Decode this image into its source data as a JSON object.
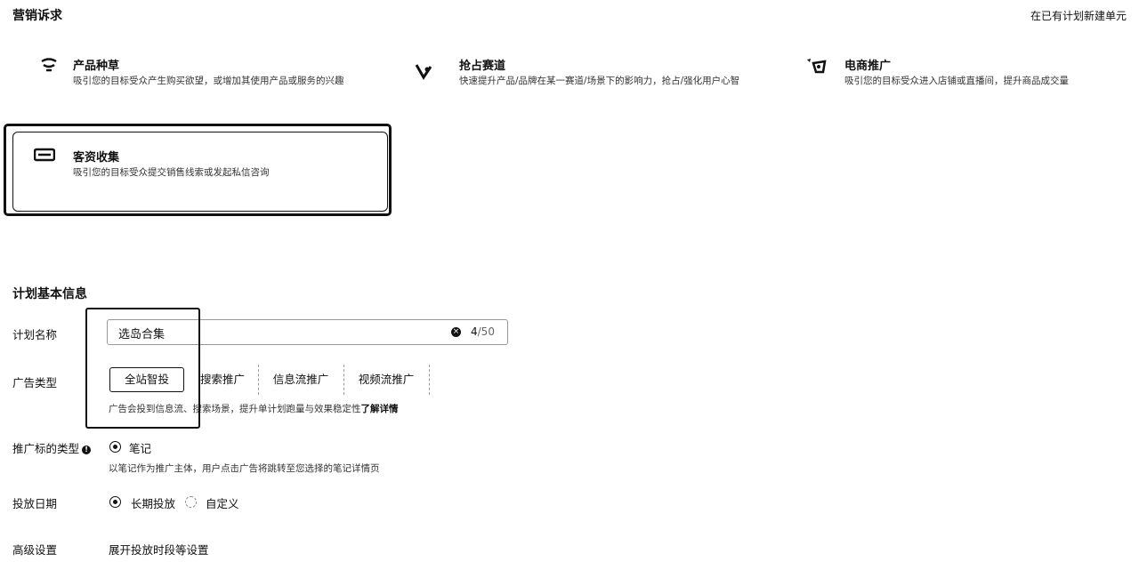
{
  "section_marketing": {
    "title": "营销诉求",
    "new_unit_link": "在已有计划新建单元"
  },
  "goals": [
    {
      "title": "产品种草",
      "desc": "吸引您的目标受众产生购买欲望，或增加其使用产品或服务的兴趣",
      "icon": "grass-icon"
    },
    {
      "title": "抢占赛道",
      "desc": "快速提升产品/品牌在某一赛道/场景下的影响力，抢占/强化用户心智",
      "icon": "track-icon"
    },
    {
      "title": "电商推广",
      "desc": "吸引您的目标受众进入店铺或直播间，提升商品成交量",
      "icon": "shop-icon"
    },
    {
      "title": "客资收集",
      "desc": "吸引您的目标受众提交销售线索或发起私信咨询",
      "icon": "lead-icon",
      "selected": true
    }
  ],
  "section_plan": {
    "title": "计划基本信息"
  },
  "plan_name": {
    "label": "计划名称",
    "value": "选岛合集",
    "count": "4",
    "max": "/50"
  },
  "ad_type": {
    "label": "广告类型",
    "options": [
      "全站智投",
      "搜索推广",
      "信息流推广",
      "视频流推广"
    ],
    "selected": "全站智投",
    "hint": "广告会投到信息流、搜索场景，提升单计划跑量与效果稳定性",
    "hint_link": "了解详情"
  },
  "target_type": {
    "label": "推广标的类型",
    "info_icon": "info-icon",
    "option": "笔记",
    "hint": "以笔记作为推广主体，用户点击广告将跳转至您选择的笔记详情页"
  },
  "schedule": {
    "label": "投放日期",
    "options": [
      "长期投放",
      "自定义"
    ],
    "selected": "长期投放"
  },
  "advanced": {
    "label": "高级设置",
    "toggle": "展开投放时段等设置"
  }
}
